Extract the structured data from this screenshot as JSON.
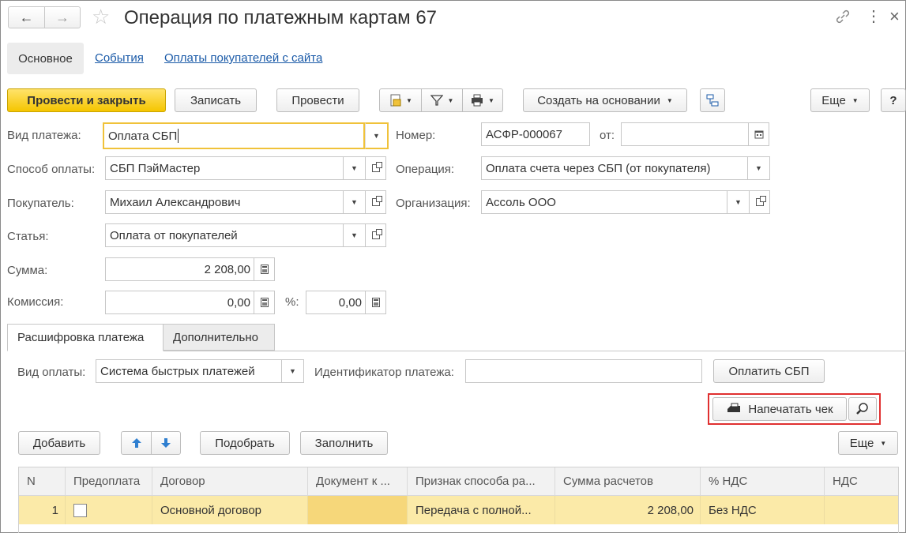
{
  "window": {
    "title": "Операция по платежным картам 67"
  },
  "nav_tabs": [
    {
      "label": "Основное",
      "active": true
    },
    {
      "label": "События"
    },
    {
      "label": "Оплаты покупателей с сайта"
    }
  ],
  "toolbar": {
    "post_close": "Провести и закрыть",
    "save": "Записать",
    "post": "Провести",
    "create_based": "Создать на основании",
    "more": "Еще",
    "help": "?"
  },
  "form": {
    "payment_type_label": "Вид платежа:",
    "payment_type_value": "Оплата СБП",
    "number_label": "Номер:",
    "number_value": "АСФР-000067",
    "date_label": "от:",
    "date_value": "",
    "method_label": "Способ оплаты:",
    "method_value": "СБП ПэйМастер",
    "operation_label": "Операция:",
    "operation_value": "Оплата счета через СБП (от покупателя)",
    "buyer_label": "Покупатель:",
    "buyer_value": "Михаил Александрович",
    "org_label": "Организация:",
    "org_value": "Ассоль ООО",
    "article_label": "Статья:",
    "article_value": "Оплата от покупателей",
    "sum_label": "Сумма:",
    "sum_value": "2 208,00",
    "commission_label": "Комиссия:",
    "commission_value": "0,00",
    "percent_label": "%:",
    "percent_value": "0,00"
  },
  "section_tabs": [
    {
      "label": "Расшифровка платежа",
      "active": true
    },
    {
      "label": "Дополнительно"
    }
  ],
  "breakdown": {
    "pay_kind_label": "Вид оплаты:",
    "pay_kind_value": "Система быстрых платежей",
    "payment_id_label": "Идентификатор платежа:",
    "payment_id_value": "",
    "pay_sbp": "Оплатить СБП",
    "print_receipt": "Напечатать чек",
    "highlight_color": "#e03030"
  },
  "table_toolbar": {
    "add": "Добавить",
    "pick": "Подобрать",
    "fill": "Заполнить",
    "more": "Еще"
  },
  "table": {
    "columns": [
      "N",
      "Предоплата",
      "Договор",
      "Документ к ...",
      "Признак способа ра...",
      "Сумма расчетов",
      "% НДС",
      "НДС"
    ],
    "rows": [
      {
        "n": "1",
        "prepay": false,
        "contract": "Основной договор",
        "doc": "",
        "method": "Передача с полной...",
        "amount": "2 208,00",
        "vat_rate": "Без НДС",
        "vat": ""
      }
    ]
  },
  "colors": {
    "primary": "#f5c500",
    "link": "#1a5aa8",
    "row_selected": "#fbeaa8",
    "focus": "#f0c23a"
  }
}
